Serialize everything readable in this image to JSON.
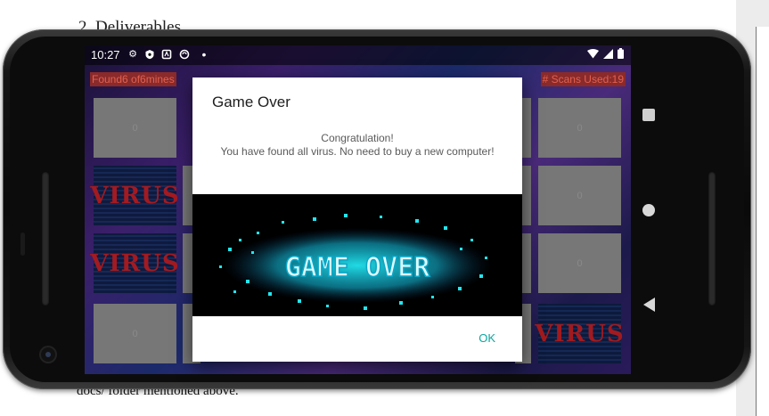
{
  "document": {
    "heading": "2. Deliverables",
    "footer_text": "docs/ folder mentioned above."
  },
  "status_bar": {
    "time": "10:27",
    "left_icons": [
      "gear-icon",
      "shield-icon",
      "app-icon",
      "sync-icon",
      "dot-icon"
    ],
    "right_icons": [
      "wifi-icon",
      "signal-icon",
      "battery-icon"
    ]
  },
  "game": {
    "found_label": "Found6 of6mines",
    "scans_label": "# Scans Used:19",
    "tile_value": "0",
    "virus_text": "VIRUS"
  },
  "dialog": {
    "title": "Game Over",
    "message_line1": "Congratulation!",
    "message_line2": "You have found all virus. No need to buy a new computer!",
    "image_text": "GAME OVER",
    "ok_label": "OK"
  },
  "navigation": [
    "recents-button",
    "home-button",
    "back-button"
  ],
  "colors": {
    "accent": "#0aa7a0",
    "label_bg": "#8a2a2a",
    "label_text": "#e06050",
    "game_over_cyan": "#22e6f0"
  }
}
